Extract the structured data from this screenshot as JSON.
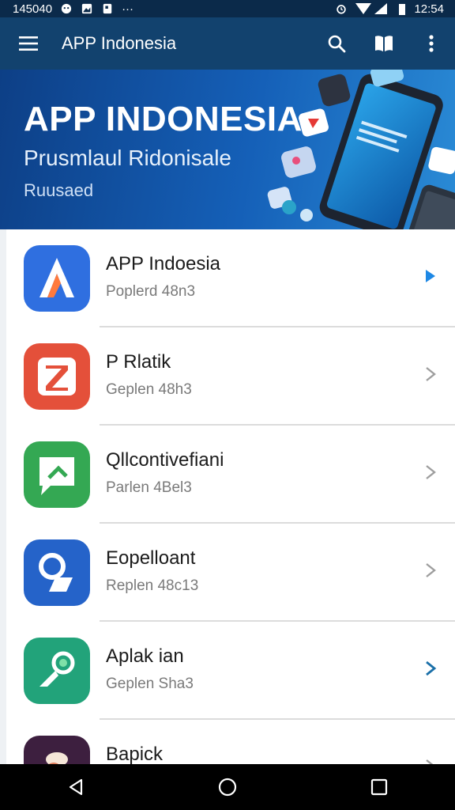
{
  "status_bar": {
    "left_text": "145040",
    "time": "12:54"
  },
  "app_bar": {
    "title": "APP Indonesia"
  },
  "banner": {
    "title": "APP INDONESIA",
    "subtitle": "Prusmlaul Ridonisale",
    "caption": "Ruusaed"
  },
  "items": [
    {
      "title": "APP Indoesia",
      "subtitle": "Poplerd 48n3",
      "icon_color": "#2f6fe0",
      "icon": "a-logo-icon",
      "chevron_color": "#1e88e5"
    },
    {
      "title": "P Rlatik",
      "subtitle": "Geplen 48h3",
      "icon_color": "#e4503a",
      "icon": "z-logo-icon",
      "chevron_color": "#9e9e9e"
    },
    {
      "title": "Qllcontivefiani",
      "subtitle": "Parlen 4Bel3",
      "icon_color": "#34a853",
      "icon": "chat-logo-icon",
      "chevron_color": "#9e9e9e"
    },
    {
      "title": "Eopelloant",
      "subtitle": "Replen 48c13",
      "icon_color": "#2563c9",
      "icon": "search-tag-logo-icon",
      "chevron_color": "#9e9e9e"
    },
    {
      "title": "Aplak ian",
      "subtitle": "Geplen Sha3",
      "icon_color": "#22a37a",
      "icon": "map-pin-logo-icon",
      "chevron_color": "#1a6fa8"
    },
    {
      "title": "Bapick",
      "subtitle": "",
      "icon_color": "#3d1f3f",
      "icon": "character-logo-icon",
      "chevron_color": "#9e9e9e"
    }
  ]
}
